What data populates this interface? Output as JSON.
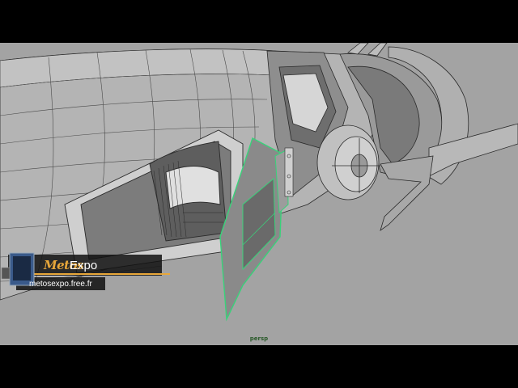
{
  "viewport": {
    "camera_label": "persp",
    "background_color": "#a3a3a3",
    "selection_color": "#39d27a",
    "wire_color": "#2a2a2a"
  },
  "watermark": {
    "logo_script": "Metos",
    "logo_word": "Expo",
    "url": "metosexpo.free.fr",
    "accent_color": "#e8a73a"
  }
}
